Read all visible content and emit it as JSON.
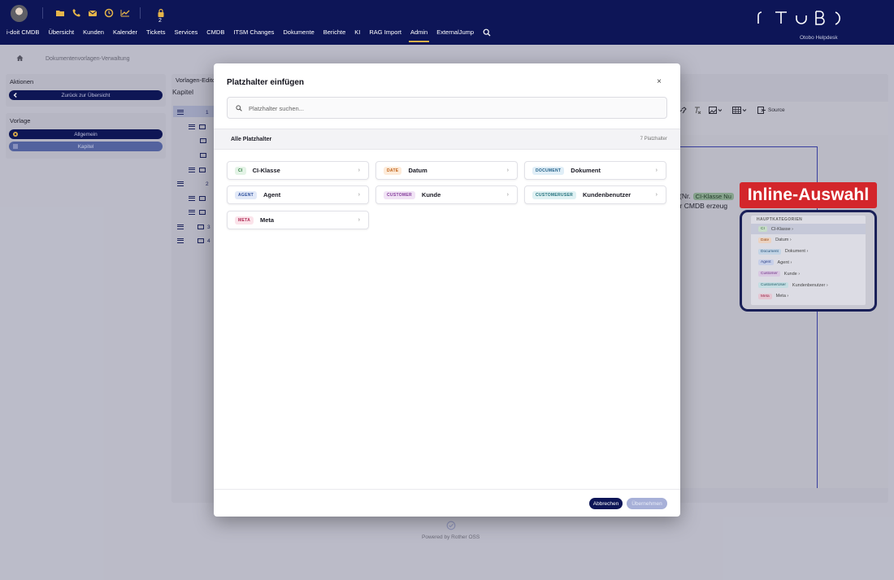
{
  "header": {
    "lock_count": "2",
    "nav": [
      "i-doit CMDB",
      "Übersicht",
      "Kunden",
      "Kalender",
      "Tickets",
      "Services",
      "CMDB",
      "ITSM Changes",
      "Dokumente",
      "Berichte",
      "KI",
      "RAG Import",
      "Admin",
      "ExternalJump"
    ],
    "active_nav": "Admin",
    "logo_subtitle": "Otobo Helpdesk"
  },
  "breadcrumb": {
    "current": "Dokumentenvorlagen-Verwaltung"
  },
  "sidebar": {
    "actions_title": "Aktionen",
    "back_label": "Zurück zur Übersicht",
    "template_title": "Vorlage",
    "general_label": "Allgemein",
    "chapter_label": "Kapitel"
  },
  "main": {
    "editor_title": "Vorlagen-Editor",
    "chapter_heading": "Kapitel",
    "tree": [
      {
        "num": "1"
      },
      {
        "num": ""
      },
      {
        "num": ""
      },
      {
        "num": ""
      },
      {
        "num": ""
      },
      {
        "num": "2"
      },
      {
        "num": ""
      },
      {
        "num": ""
      },
      {
        "num": "3"
      },
      {
        "num": "4"
      }
    ],
    "toolbar_source": "Source",
    "text_line1_prefix": "(Nr.",
    "text_chip": "CI-Klasse Nu",
    "text_line2": "n der CMDB erzeug"
  },
  "footer": {
    "powered_by": "Powered by Rother OSS"
  },
  "modal": {
    "title": "Platzhalter einfügen",
    "close": "×",
    "search_placeholder": "Platzhalter suchen...",
    "list_title": "Alle Platzhalter",
    "count": "7 Platzhalter",
    "cancel": "Abbrechen",
    "apply": "Übernehmen",
    "cards": [
      {
        "badge": "CI",
        "label": "CI-Klasse",
        "bg": "#e3f3e6",
        "fg": "#2f7d3f"
      },
      {
        "badge": "DATE",
        "label": "Datum",
        "bg": "#fdebd9",
        "fg": "#c06016"
      },
      {
        "badge": "DOCUMENT",
        "label": "Dokument",
        "bg": "#e0eef7",
        "fg": "#23628a"
      },
      {
        "badge": "AGENT",
        "label": "Agent",
        "bg": "#e2e9f8",
        "fg": "#2d4f9c"
      },
      {
        "badge": "CUSTOMER",
        "label": "Kunde",
        "bg": "#f1e3f5",
        "fg": "#83399a"
      },
      {
        "badge": "CUSTOMERUSER",
        "label": "Kundenbenutzer",
        "bg": "#dff1f3",
        "fg": "#1f6f7a"
      },
      {
        "badge": "META",
        "label": "Meta",
        "bg": "#fbe3ea",
        "fg": "#b02a55"
      }
    ]
  },
  "callout": {
    "text": "Inline-Auswahl"
  },
  "inline_popup": {
    "heading": "HAUPTKATEGORIEN",
    "items": [
      {
        "badge": "CI",
        "label": "CI-Klasse ›",
        "bg": "#c7dcc9",
        "fg": "#2f5f36"
      },
      {
        "badge": "Date",
        "label": "Datum ›",
        "bg": "#ebd2c0",
        "fg": "#9a4d1a"
      },
      {
        "badge": "Document",
        "label": "Dokument ›",
        "bg": "#c3d4e5",
        "fg": "#234f78"
      },
      {
        "badge": "Agent",
        "label": "Agent ›",
        "bg": "#c7cfe8",
        "fg": "#2d4287"
      },
      {
        "badge": "Customer",
        "label": "Kunde ›",
        "bg": "#d9c8e2",
        "fg": "#6d2f84"
      },
      {
        "badge": "CustomerUser",
        "label": "Kundenbenutzer ›",
        "bg": "#c4dde2",
        "fg": "#1f5d67"
      },
      {
        "badge": "Meta",
        "label": "Meta ›",
        "bg": "#e5c6d2",
        "fg": "#972548"
      }
    ]
  }
}
